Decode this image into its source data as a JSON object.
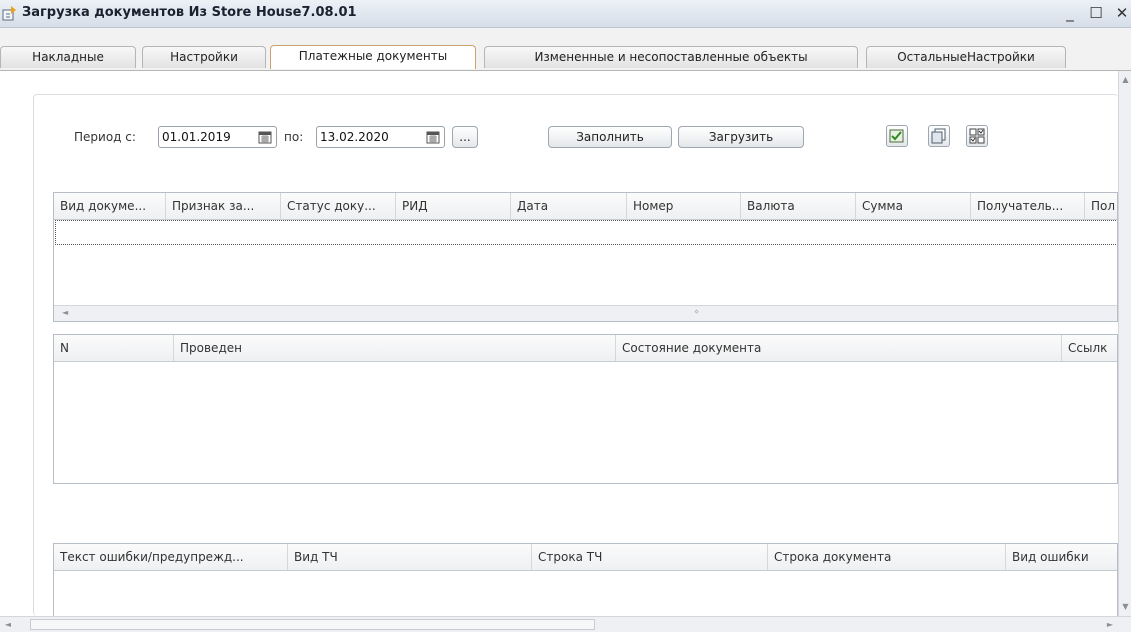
{
  "window": {
    "title": "Загрузка документов Из Store House7.08.01",
    "minimize": "_",
    "maximize": "☐",
    "close": "✕"
  },
  "tabs": [
    {
      "label": "Накладные",
      "active": false
    },
    {
      "label": "Настройки",
      "active": false
    },
    {
      "label": "Платежные документы",
      "active": true
    },
    {
      "label": "Измененные и несопоставленные объекты",
      "active": false
    },
    {
      "label": "ОстальныеНастройки",
      "active": false
    }
  ],
  "period": {
    "from_label": "Период с:",
    "from_value": "01.01.2019",
    "to_label": "по:",
    "to_value": "13.02.2020",
    "more_button": "..."
  },
  "toolbar": {
    "fill_button": "Заполнить",
    "load_button": "Загрузить",
    "icons": [
      "check-all-icon",
      "copy-icon",
      "toggle-checkboxes-icon"
    ]
  },
  "documents_table": {
    "columns": [
      "Вид докуме...",
      "Признак за...",
      "Статус доку...",
      "РИД",
      "Дата",
      "Номер",
      "Валюта",
      "Сумма",
      "Получатель...",
      "Пол"
    ],
    "rows": []
  },
  "results_table": {
    "columns": [
      "N",
      "Проведен",
      "Состояние документа",
      "Ссылк"
    ],
    "rows": []
  },
  "errors_table": {
    "columns": [
      "Текст ошибки/предупрежд...",
      "Вид ТЧ",
      "Строка ТЧ",
      "Строка документа",
      "Вид ошибки"
    ],
    "rows": []
  },
  "colors": {
    "active_tab_border": "#c9a46a",
    "header_bg": "#eef0f2",
    "border": "#b8bec6"
  }
}
